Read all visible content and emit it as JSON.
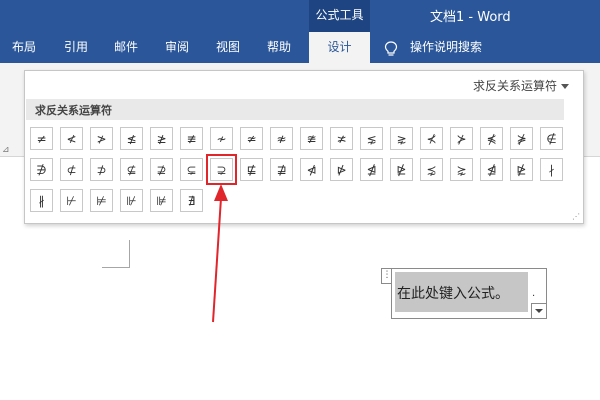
{
  "window": {
    "context_group": "公式工具",
    "doc_title": "文档1 - Word"
  },
  "tabs": [
    {
      "label": "布局"
    },
    {
      "label": "引用"
    },
    {
      "label": "邮件"
    },
    {
      "label": "审阅"
    },
    {
      "label": "视图"
    },
    {
      "label": "帮助"
    },
    {
      "label": "设计",
      "active": true
    }
  ],
  "tell_me": {
    "label": "操作说明搜索",
    "icon": "lightbulb-icon"
  },
  "gallery": {
    "selector_label": "求反关系运算符",
    "section_header": "求反关系运算符",
    "selected_index": 24,
    "symbols": [
      "≠",
      "≮",
      "≯",
      "≰",
      "≱",
      "≢",
      "≁",
      "≄",
      "≉",
      "≇",
      "≭",
      "⋦",
      "⋧",
      "⊀",
      "⊁",
      "⋠",
      "⋡",
      "∉",
      "∌",
      "⊄",
      "⊅",
      "⊈",
      "⊉",
      "⊊",
      "⊋",
      "⋢",
      "⋣",
      "⋪",
      "⋫",
      "⋬",
      "⋭",
      "⋨",
      "⋩",
      "⋬",
      "⋭",
      "∤",
      "∦",
      "⊬",
      "⊭",
      "⊮",
      "⊯",
      "∄"
    ]
  },
  "document": {
    "equation_placeholder": "在此处键入公式。"
  },
  "colors": {
    "ribbon_blue": "#2b579a",
    "annotation_red": "#e0262b"
  }
}
